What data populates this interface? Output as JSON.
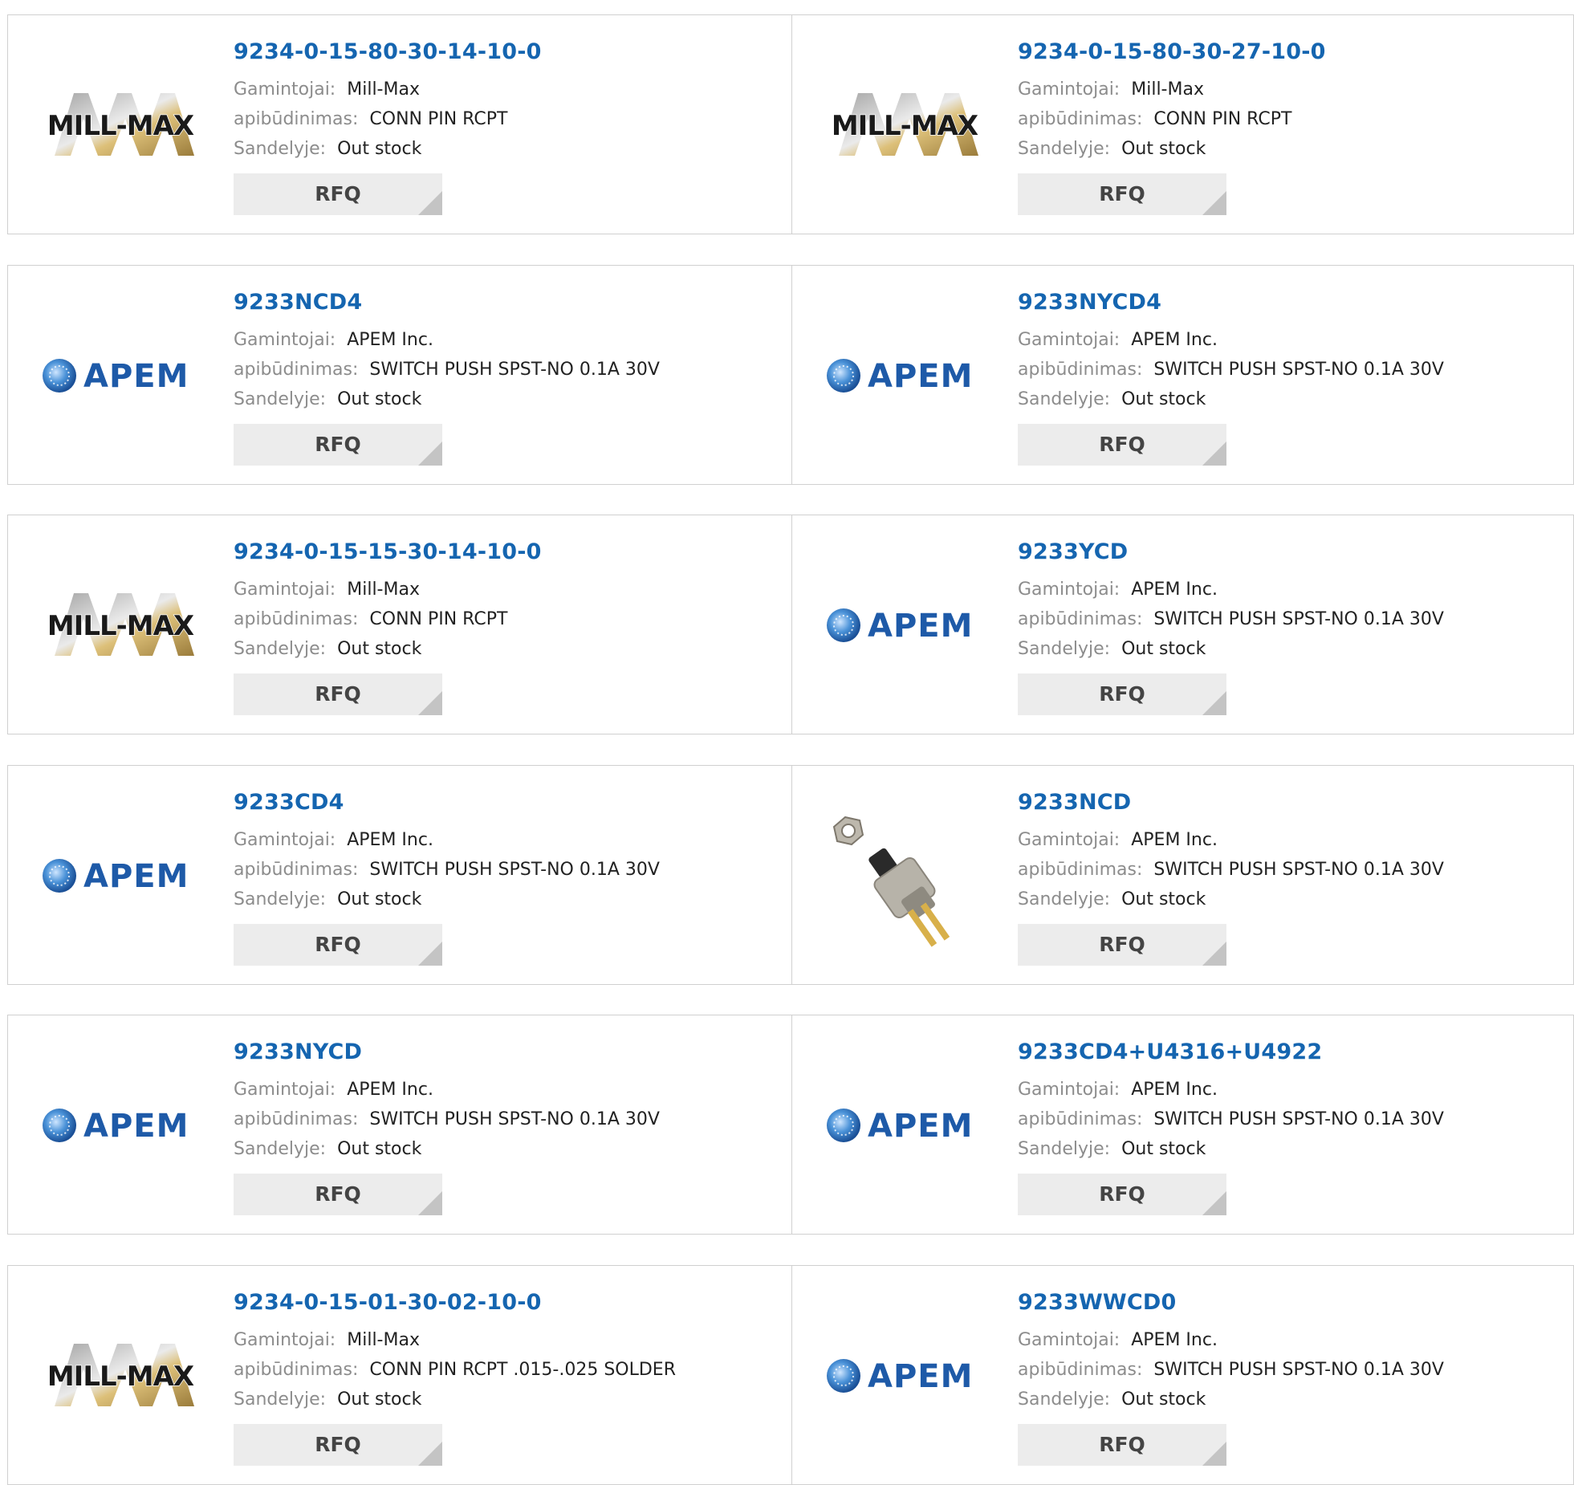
{
  "labels": {
    "manufacturer": "Gamintojai:",
    "description": "apibūdinimas:",
    "stock": "Sandelyje:",
    "rfq": "RFQ"
  },
  "products": [
    {
      "part": "9234-0-15-80-30-14-10-0",
      "manufacturer": "Mill-Max",
      "description": "CONN PIN RCPT",
      "stock": "Out stock",
      "logo": "millmax-logo"
    },
    {
      "part": "9234-0-15-80-30-27-10-0",
      "manufacturer": "Mill-Max",
      "description": "CONN PIN RCPT",
      "stock": "Out stock",
      "logo": "millmax-logo"
    },
    {
      "part": "9233NCD4",
      "manufacturer": "APEM Inc.",
      "description": "SWITCH PUSH SPST-NO 0.1A 30V",
      "stock": "Out stock",
      "logo": "apem-logo"
    },
    {
      "part": "9233NYCD4",
      "manufacturer": "APEM Inc.",
      "description": "SWITCH PUSH SPST-NO 0.1A 30V",
      "stock": "Out stock",
      "logo": "apem-logo"
    },
    {
      "part": "9234-0-15-15-30-14-10-0",
      "manufacturer": "Mill-Max",
      "description": "CONN PIN RCPT",
      "stock": "Out stock",
      "logo": "millmax-logo"
    },
    {
      "part": "9233YCD",
      "manufacturer": "APEM Inc.",
      "description": "SWITCH PUSH SPST-NO 0.1A 30V",
      "stock": "Out stock",
      "logo": "apem-logo"
    },
    {
      "part": "9233CD4",
      "manufacturer": "APEM Inc.",
      "description": "SWITCH PUSH SPST-NO 0.1A 30V",
      "stock": "Out stock",
      "logo": "apem-logo"
    },
    {
      "part": "9233NCD",
      "manufacturer": "APEM Inc.",
      "description": "SWITCH PUSH SPST-NO 0.1A 30V",
      "stock": "Out stock",
      "logo": "switch-photo"
    },
    {
      "part": "9233NYCD",
      "manufacturer": "APEM Inc.",
      "description": "SWITCH PUSH SPST-NO 0.1A 30V",
      "stock": "Out stock",
      "logo": "apem-logo"
    },
    {
      "part": "9233CD4+U4316+U4922",
      "manufacturer": "APEM Inc.",
      "description": "SWITCH PUSH SPST-NO 0.1A 30V",
      "stock": "Out stock",
      "logo": "apem-logo"
    },
    {
      "part": "9234-0-15-01-30-02-10-0",
      "manufacturer": "Mill-Max",
      "description": "CONN PIN RCPT .015-.025 SOLDER",
      "stock": "Out stock",
      "logo": "millmax-logo"
    },
    {
      "part": "9233WWCD0",
      "manufacturer": "APEM Inc.",
      "description": "SWITCH PUSH SPST-NO 0.1A 30V",
      "stock": "Out stock",
      "logo": "apem-logo"
    }
  ],
  "logo_text": {
    "millmax": "MILL-MAX",
    "apem": "APEM"
  },
  "colors": {
    "part_link": "#1565b0",
    "apem_blue": "#1e5aa8",
    "millmax_gold": "#c9a24a"
  }
}
